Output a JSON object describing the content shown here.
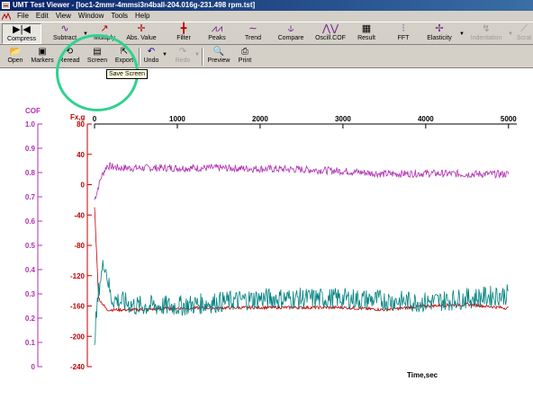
{
  "window": {
    "title": "UMT Test Viewer - [loc1-2mmr-4mmsi3n4ball-204.016g-231.498 rpm.tst]"
  },
  "menu": [
    "File",
    "Edit",
    "View",
    "Window",
    "Tools",
    "Help"
  ],
  "toolbar": {
    "buttons": [
      {
        "label": "Compress",
        "icon": "compress-icon"
      },
      {
        "label": "Subtract",
        "icon": "subtract-icon"
      },
      {
        "label": "Multiply",
        "icon": "multiply-icon"
      },
      {
        "label": "Abs. Value",
        "icon": "abs-value-icon"
      },
      {
        "label": "Filter",
        "icon": "filter-icon"
      },
      {
        "label": "Peaks",
        "icon": "peaks-icon"
      },
      {
        "label": "Trend",
        "icon": "trend-icon"
      },
      {
        "label": "Compare",
        "icon": "compare-icon"
      },
      {
        "label": "Oscill.COF",
        "icon": "oscill-cof-icon"
      },
      {
        "label": "Result",
        "icon": "result-icon"
      },
      {
        "label": "FFT",
        "icon": "fft-icon"
      },
      {
        "label": "Elasticity",
        "icon": "elasticity-icon"
      },
      {
        "label": "Indentation",
        "icon": "indentation-icon"
      },
      {
        "label": "Scrat",
        "icon": "scratch-icon"
      }
    ]
  },
  "toolbar2": {
    "buttons": [
      {
        "label": "Open",
        "icon": "open-folder-icon"
      },
      {
        "label": "Markers",
        "icon": "markers-icon"
      },
      {
        "label": "Reread",
        "icon": "reread-icon"
      },
      {
        "label": "Screen",
        "icon": "screen-icon"
      },
      {
        "label": "Export",
        "icon": "export-icon"
      },
      {
        "label": "Undo",
        "icon": "undo-icon"
      },
      {
        "label": "Redo",
        "icon": "redo-icon"
      },
      {
        "label": "Preview",
        "icon": "preview-icon"
      },
      {
        "label": "Print",
        "icon": "print-icon"
      }
    ]
  },
  "tooltip": "Save Screen",
  "colors": {
    "cof": "#b030b0",
    "fx": "#c00000",
    "noisy": "#008080",
    "highlight": "#2fd28f"
  },
  "chart_data": {
    "type": "line",
    "xlabel": "Time,sec",
    "x_ticks": [
      0,
      1000,
      2000,
      3000,
      4000,
      5000
    ],
    "xlim": [
      0,
      5100
    ],
    "cof_axis": {
      "label": "COF",
      "ticks": [
        "1.0",
        "0.9",
        "0.8",
        "0.7",
        "0.6",
        "0.5",
        "0.4",
        "0.3",
        "0.2",
        "0.1",
        "0"
      ],
      "ylim": [
        0,
        1.0
      ]
    },
    "fx_axis": {
      "label": "Fx,g",
      "ticks": [
        "80",
        "40",
        "0",
        "-40",
        "-80",
        "-120",
        "-160",
        "-200",
        "-240"
      ],
      "ylim": [
        -240,
        80
      ]
    },
    "series": [
      {
        "color_key": "cof",
        "axis": "fx",
        "points": [
          [
            0,
            -20
          ],
          [
            80,
            10
          ],
          [
            150,
            25
          ],
          [
            300,
            22
          ],
          [
            800,
            22
          ],
          [
            1500,
            22
          ],
          [
            2500,
            20
          ],
          [
            3000,
            18
          ],
          [
            3500,
            14
          ],
          [
            4000,
            15
          ],
          [
            4500,
            14
          ],
          [
            5000,
            14
          ]
        ],
        "noise": 5
      },
      {
        "color_key": "fx",
        "axis": "fx",
        "points": [
          [
            0,
            -30
          ],
          [
            50,
            -150
          ],
          [
            150,
            -165
          ],
          [
            500,
            -165
          ],
          [
            1000,
            -163
          ],
          [
            2000,
            -162
          ],
          [
            3000,
            -162
          ],
          [
            3500,
            -165
          ],
          [
            4000,
            -160
          ],
          [
            4500,
            -158
          ],
          [
            5000,
            -163
          ]
        ],
        "noise": 2
      },
      {
        "color_key": "noisy",
        "axis": "fx",
        "points": [
          [
            0,
            -200
          ],
          [
            60,
            -130
          ],
          [
            120,
            -100
          ],
          [
            200,
            -150
          ],
          [
            500,
            -160
          ],
          [
            1000,
            -160
          ],
          [
            2000,
            -150
          ],
          [
            3000,
            -150
          ],
          [
            4000,
            -155
          ],
          [
            4500,
            -150
          ],
          [
            5000,
            -145
          ]
        ],
        "noise": 14
      }
    ]
  }
}
